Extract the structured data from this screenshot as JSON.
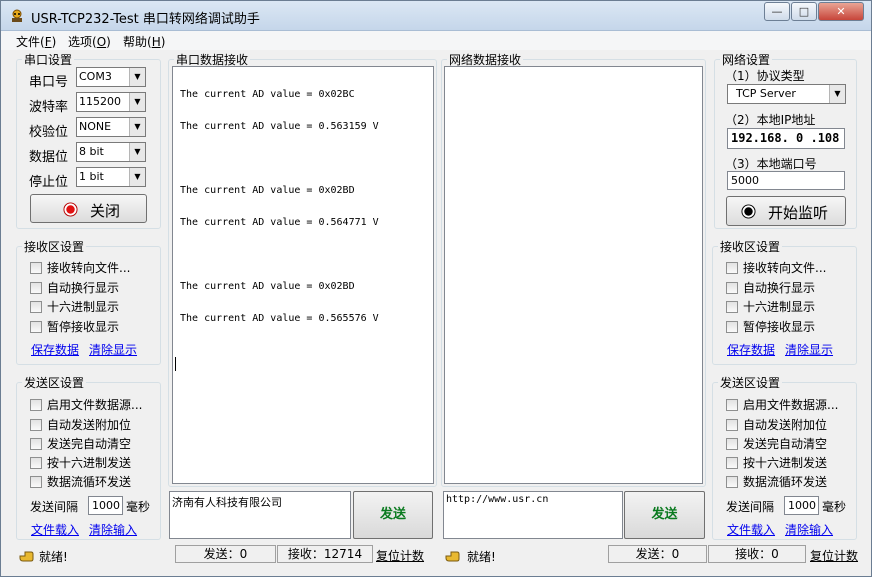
{
  "window": {
    "title": "USR-TCP232-Test 串口转网络调试助手",
    "minimize_label": "—",
    "maximize_label": "□",
    "close_label": "✕"
  },
  "menu": {
    "items": [
      {
        "label": "文件(",
        "key": "F",
        "suffix": ")"
      },
      {
        "label": "选项(",
        "key": "O",
        "suffix": ")"
      },
      {
        "label": "帮助(",
        "key": "H",
        "suffix": ")"
      }
    ]
  },
  "serial_settings": {
    "title": "串口设置",
    "port_label": "串口号",
    "port_value": "COM3",
    "baud_label": "波特率",
    "baud_value": "115200",
    "parity_label": "校验位",
    "parity_value": "NONE",
    "databits_label": "数据位",
    "databits_value": "8 bit",
    "stopbits_label": "停止位",
    "stopbits_value": "1 bit",
    "close_button": "关闭"
  },
  "left_receive_settings": {
    "title": "接收区设置",
    "options": [
      "接收转向文件...",
      "自动换行显示",
      "十六进制显示",
      "暂停接收显示"
    ],
    "save_link": "保存数据",
    "clear_link": "清除显示"
  },
  "left_send_settings": {
    "title": "发送区设置",
    "options": [
      "启用文件数据源...",
      "自动发送附加位",
      "发送完自动清空",
      "按十六进制发送",
      "数据流循环发送"
    ],
    "interval_label": "发送间隔",
    "interval_value": "1000",
    "interval_unit": "毫秒",
    "load_link": "文件载入",
    "clear_link": "清除输入"
  },
  "serial_receive": {
    "title": "串口数据接收",
    "lines": [
      "The current AD value = 0x02BC",
      "The current AD value = 0.563159 V",
      "The current AD value = 0x02BD",
      "The current AD value = 0.564771 V",
      "The current AD value = 0x02BD",
      "The current AD value = 0.565576 V"
    ]
  },
  "network_receive": {
    "title": "网络数据接收"
  },
  "serial_send": {
    "input_value": "济南有人科技有限公司",
    "send_button": "发送"
  },
  "network_send": {
    "input_value": "http://www.usr.cn",
    "send_button": "发送"
  },
  "network_settings": {
    "title": "网络设置",
    "protocol_label": "（1）协议类型",
    "protocol_value": "TCP Server",
    "ip_label": "（2）本地IP地址",
    "ip_value": "192.168. 0 .108",
    "port_label": "（3）本地端口号",
    "port_value": "5000",
    "listen_button": "开始监听"
  },
  "right_receive_settings": {
    "title": "接收区设置",
    "options": [
      "接收转向文件...",
      "自动换行显示",
      "十六进制显示",
      "暂停接收显示"
    ],
    "save_link": "保存数据",
    "clear_link": "清除显示"
  },
  "right_send_settings": {
    "title": "发送区设置",
    "options": [
      "启用文件数据源...",
      "自动发送附加位",
      "发送完自动清空",
      "按十六进制发送",
      "数据流循环发送"
    ],
    "interval_label": "发送间隔",
    "interval_value": "1000",
    "interval_unit": "毫秒",
    "load_link": "文件载入",
    "clear_link": "清除输入"
  },
  "status_left": {
    "status_text": "就绪!",
    "send_count": "发送：0",
    "recv_count": "接收：12714",
    "reset_label": "复位计数"
  },
  "status_right": {
    "status_text": "就绪!",
    "send_count": "发送：0",
    "recv_count": "接收：0",
    "reset_label": "复位计数"
  },
  "colors": {
    "send_button_text": "#0a7a1f",
    "link": "#0000ee",
    "close_indicator": "#e01010"
  },
  "icons": [
    "app-icon",
    "status-indicator-icon",
    "listen-indicator-icon",
    "hand-icon"
  ]
}
